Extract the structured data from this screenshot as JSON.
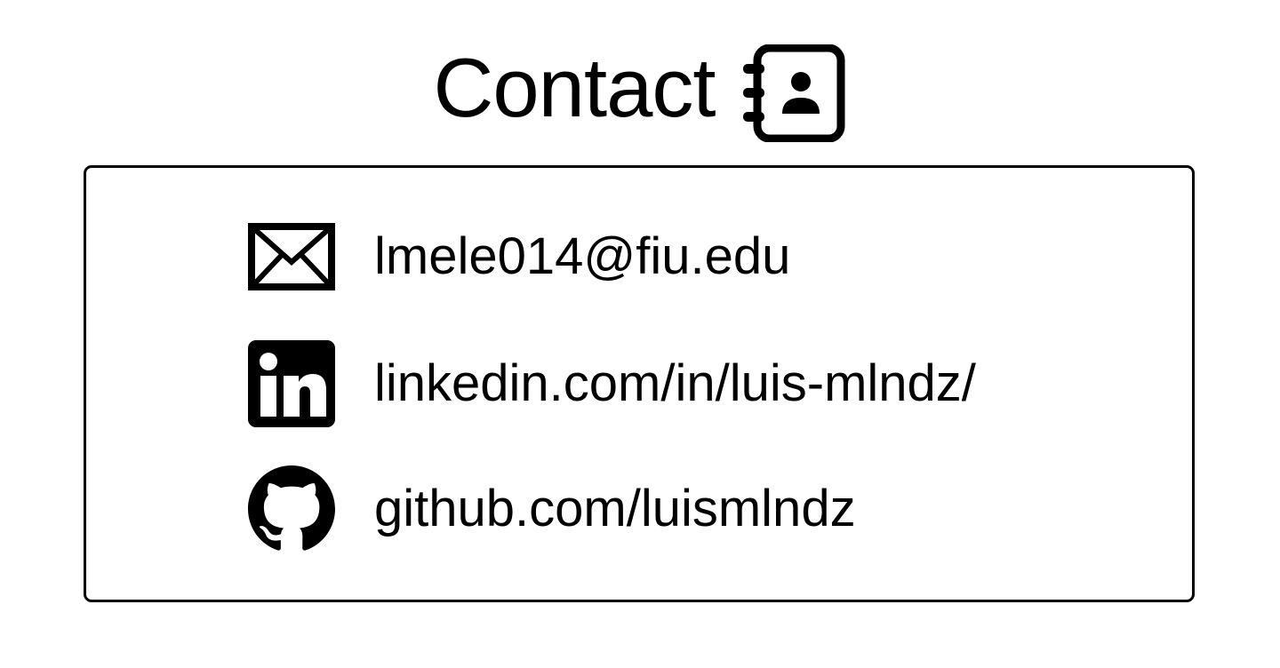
{
  "header": {
    "title": "Contact",
    "icon": "contact-book-icon"
  },
  "contacts": [
    {
      "icon": "envelope-icon",
      "label": "lmele014@fiu.edu"
    },
    {
      "icon": "linkedin-icon",
      "label": "linkedin.com/in/luis-mlndz/"
    },
    {
      "icon": "github-icon",
      "label": "github.com/luismlndz"
    }
  ],
  "colors": {
    "foreground": "#000000",
    "background": "#ffffff"
  }
}
